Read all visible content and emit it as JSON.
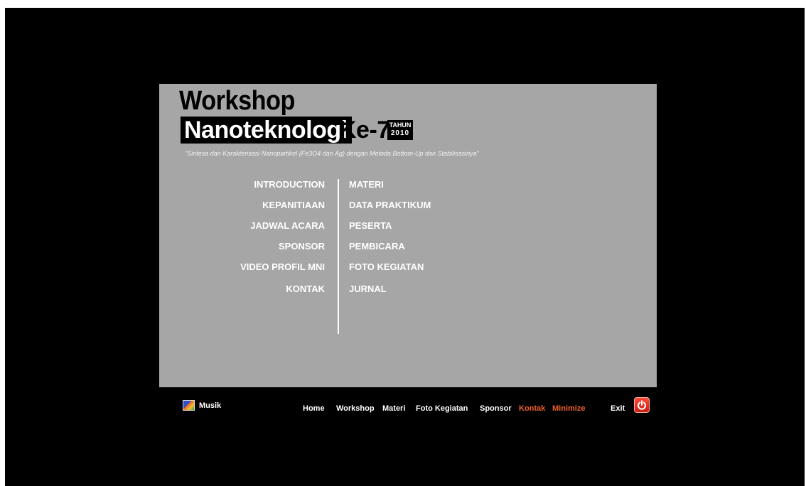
{
  "header": {
    "title_line1": "Workshop",
    "title_line2": "Nanoteknologi",
    "title_ke": "Ke-7",
    "year_label": "TAHUN",
    "year": "2010",
    "subtitle": "\"Sintesa dan Karakterisasi Nanopartikel (Fe3O4 dan Ag) dengan Metoda Bottom-Up dan Stabilisasinya\""
  },
  "menu": {
    "left": [
      {
        "label": "INTRODUCTION"
      },
      {
        "label": "KEPANITIAAN"
      },
      {
        "label": "JADWAL ACARA"
      },
      {
        "label": "SPONSOR"
      },
      {
        "label": "VIDEO PROFIL MNI"
      },
      {
        "label": "KONTAK"
      }
    ],
    "right": [
      {
        "label": "MATERI"
      },
      {
        "label": "DATA PRAKTIKUM"
      },
      {
        "label": "PESERTA"
      },
      {
        "label": "PEMBICARA"
      },
      {
        "label": "FOTO KEGIATAN"
      },
      {
        "label": "JURNAL"
      }
    ]
  },
  "footer": {
    "music_label": "Musik",
    "nav": {
      "home": "Home",
      "workshop": "Workshop",
      "materi": "Materi",
      "foto_kegiatan": "Foto Kegiatan",
      "sponsor": "Sponsor",
      "kontak": "Kontak",
      "minimize": "Minimize",
      "exit": "Exit"
    }
  },
  "colors": {
    "background": "#000000",
    "panel": "#a6a6a6",
    "menu_text": "#ffffff",
    "accent": "#f0602a",
    "power_button": "#e0301f"
  },
  "icons": {
    "music": "music-image-icon",
    "exit": "power-icon"
  }
}
